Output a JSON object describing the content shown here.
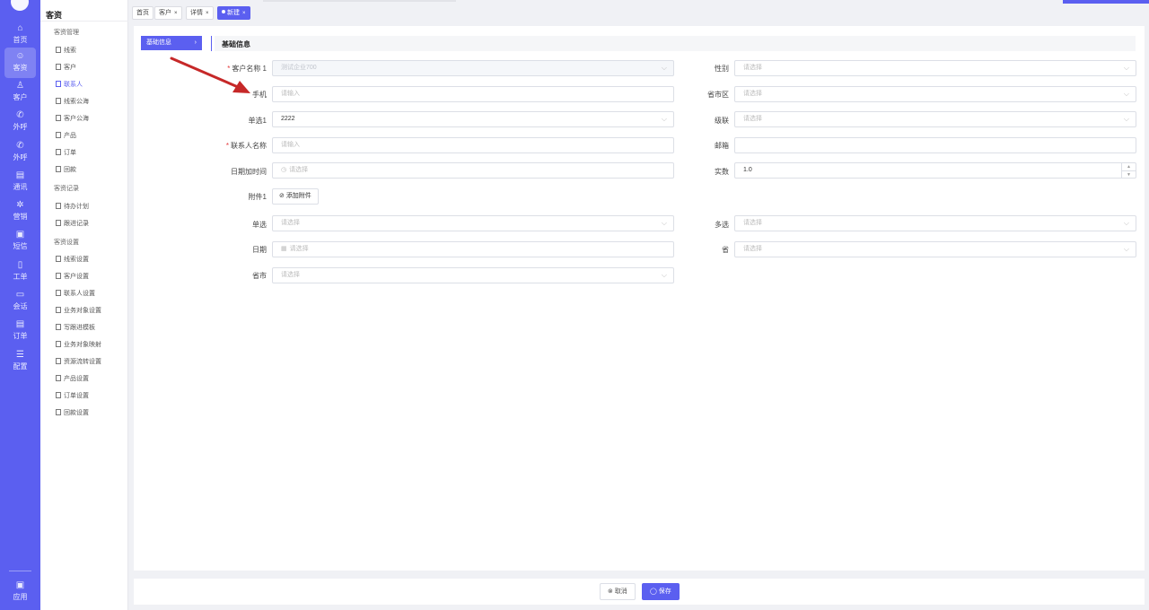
{
  "rail": {
    "items": [
      {
        "icon": "home-icon",
        "glyph": "⌂",
        "label": "首页"
      },
      {
        "icon": "users-icon",
        "glyph": "☺",
        "label": "客资"
      },
      {
        "icon": "customer-icon",
        "glyph": "♙",
        "label": "客户"
      },
      {
        "icon": "phone-icon",
        "glyph": "✆",
        "label": "外呼"
      },
      {
        "icon": "phone-out-icon",
        "glyph": "✆",
        "label": "外呼"
      },
      {
        "icon": "contacts-icon",
        "glyph": "▤",
        "label": "通讯"
      },
      {
        "icon": "marketing-icon",
        "glyph": "✲",
        "label": "营销"
      },
      {
        "icon": "sms-icon",
        "glyph": "▣",
        "label": "短信"
      },
      {
        "icon": "ticket-icon",
        "glyph": "▯",
        "label": "工单"
      },
      {
        "icon": "chat-icon",
        "glyph": "▭",
        "label": "会话"
      },
      {
        "icon": "order-icon",
        "glyph": "▤",
        "label": "订单"
      },
      {
        "icon": "settings-icon",
        "glyph": "☰",
        "label": "配置"
      }
    ],
    "bottom": {
      "icon": "apps-icon",
      "glyph": "▣",
      "label": "应用"
    }
  },
  "sidebar": {
    "title": "客资",
    "groups": [
      {
        "title": "客资管理",
        "items": [
          "线索",
          "客户",
          "联系人",
          "线索公海",
          "客户公海",
          "产品",
          "订单",
          "回款"
        ]
      },
      {
        "title": "客资记录",
        "items": [
          "待办计划",
          "跟进记录"
        ]
      },
      {
        "title": "客资设置",
        "items": [
          "线索设置",
          "客户设置",
          "联系人设置",
          "业务对象设置",
          "写跟进模板",
          "业务对象映射",
          "资源流转设置",
          "产品设置",
          "订单设置",
          "回款设置"
        ]
      }
    ],
    "active_item": "联系人"
  },
  "tabs": [
    {
      "label": "首页",
      "closable": false
    },
    {
      "label": "客户",
      "closable": true
    },
    {
      "label": "详情",
      "closable": true
    },
    {
      "label": "新建",
      "closable": true,
      "active": true
    }
  ],
  "nav": {
    "label": "基础信息",
    "chevron": "›"
  },
  "section": {
    "title": "基础信息"
  },
  "form": {
    "customer_name": {
      "label": "客户名称 1",
      "required": true,
      "value": "测试企业700"
    },
    "gender": {
      "label": "性别",
      "placeholder": "请选择"
    },
    "mobile": {
      "label": "手机",
      "placeholder": "请输入"
    },
    "region": {
      "label": "省市区",
      "placeholder": "请选择"
    },
    "single1": {
      "label": "单选1",
      "value": "2222"
    },
    "cascade": {
      "label": "级联",
      "placeholder": "请选择"
    },
    "contact_name": {
      "label": "联系人名称",
      "required": true,
      "placeholder": "请输入"
    },
    "email": {
      "label": "邮箱",
      "value": ""
    },
    "datetime": {
      "label": "日期加时间",
      "placeholder": "请选择"
    },
    "real_number": {
      "label": "实数",
      "value": "1.0"
    },
    "attachment": {
      "label": "附件1",
      "button": "添加附件"
    },
    "single": {
      "label": "单选",
      "placeholder": "请选择"
    },
    "multi": {
      "label": "多选",
      "placeholder": "请选择"
    },
    "date": {
      "label": "日期",
      "placeholder": "请选择"
    },
    "province": {
      "label": "省",
      "placeholder": "请选择"
    },
    "city": {
      "label": "省市",
      "placeholder": "请选择"
    }
  },
  "footer": {
    "cancel": "取消",
    "save": "保存"
  },
  "colors": {
    "accent": "#5b5ff0",
    "required": "#e4393c",
    "annotation_arrow": "#c62828"
  }
}
